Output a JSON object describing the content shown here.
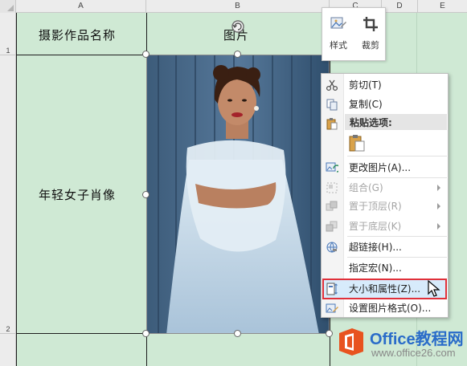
{
  "columns": [
    {
      "label": "A"
    },
    {
      "label": "B"
    },
    {
      "label": "C"
    },
    {
      "label": "D"
    },
    {
      "label": "E"
    }
  ],
  "rows": [
    {
      "label": "1"
    },
    {
      "label": "2"
    }
  ],
  "cells": {
    "a1": "摄影作品名称",
    "b1": "图片",
    "a2": "年轻女子肖像"
  },
  "mini_toolbar": {
    "style_label": "样式",
    "crop_label": "裁剪"
  },
  "context_menu": {
    "cut": "剪切(T)",
    "copy": "复制(C)",
    "paste_header": "粘贴选项:",
    "change_picture": "更改图片(A)...",
    "group": "组合(G)",
    "bring_to_front": "置于顶层(R)",
    "send_to_back": "置于底层(K)",
    "hyperlink": "超链接(H)...",
    "assign_macro": "指定宏(N)...",
    "size_properties": "大小和属性(Z)...",
    "format_picture": "设置图片格式(O)..."
  },
  "watermark": {
    "title": "Office教程网",
    "url": "www.office26.com"
  },
  "colors": {
    "cell_fill": "#cfe9d4",
    "highlight_border": "#e0303a",
    "highlight_fill": "#d7ebfb",
    "brand_orange": "#e8531f",
    "brand_blue": "#2a6cc9"
  }
}
